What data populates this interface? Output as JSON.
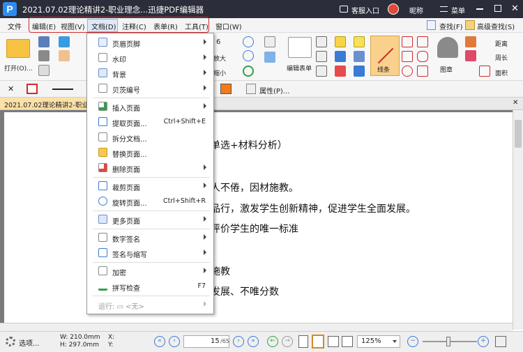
{
  "window": {
    "title": "2021.07.02理论精讲2-职业理念...迅捷PDF编辑器",
    "customer_service": "客服入口",
    "user_name": "昵称",
    "menu_label": "菜单"
  },
  "menubar": {
    "items": [
      "文件",
      "编辑(E)",
      "视图(V)",
      "文档(D)",
      "注释(C)",
      "表单(R)",
      "工具(T)",
      "窗口(W)"
    ],
    "find_label": "查找(F)",
    "advanced_find_label": "高级查找(S)"
  },
  "ribbon": {
    "open_label": "打开(O)...",
    "zoom_in_label": "放大",
    "zoom_out_label": "缩小",
    "edit_form_label": "编辑表单",
    "line_label": "线条",
    "stamp_label": "图章",
    "distance_label": "距离",
    "perimeter_label": "周长",
    "area_label": "面积",
    "partial_zoom": "6"
  },
  "formatbar": {
    "properties_label": "属性(P)..."
  },
  "tab": {
    "label": "2021.07.02理论精讲2-职业理"
  },
  "document": {
    "lines": [
      "单选+材料分析）",
      "人不倦，因材施教。",
      "品行，激发学生创新精神，促进学生全面发展。",
      "评价学生的唯一标准",
      "施教",
      "发展、不唯分数"
    ]
  },
  "dropdown": {
    "items": [
      {
        "label": "页眉页脚",
        "shortcut": "",
        "submenu": true,
        "icon": "header-footer-icon"
      },
      {
        "label": "水印",
        "shortcut": "",
        "submenu": true,
        "icon": "watermark-icon"
      },
      {
        "label": "背景",
        "shortcut": "",
        "submenu": true,
        "icon": "background-icon"
      },
      {
        "label": "贝茨编号",
        "shortcut": "",
        "submenu": true,
        "icon": "bates-number-icon"
      },
      {
        "label": "插入页面",
        "shortcut": "",
        "submenu": true,
        "icon": "insert-page-icon"
      },
      {
        "label": "提取页面...",
        "shortcut": "Ctrl+Shift+E",
        "submenu": false,
        "icon": "extract-page-icon"
      },
      {
        "label": "拆分文档...",
        "shortcut": "",
        "submenu": false,
        "icon": "split-document-icon"
      },
      {
        "label": "替换页面...",
        "shortcut": "",
        "submenu": false,
        "icon": "replace-page-icon"
      },
      {
        "label": "删除页面",
        "shortcut": "",
        "submenu": true,
        "icon": "delete-page-icon"
      },
      {
        "label": "裁剪页面",
        "shortcut": "",
        "submenu": true,
        "icon": "crop-page-icon"
      },
      {
        "label": "旋转页面...",
        "shortcut": "Ctrl+Shift+R",
        "submenu": false,
        "icon": "rotate-page-icon"
      },
      {
        "label": "更多页面",
        "shortcut": "",
        "submenu": true,
        "icon": "more-pages-icon"
      },
      {
        "label": "数字签名",
        "shortcut": "",
        "submenu": true,
        "icon": "digital-signature-icon"
      },
      {
        "label": "签名与缩写",
        "shortcut": "",
        "submenu": true,
        "icon": "sign-initial-icon"
      },
      {
        "label": "加密",
        "shortcut": "",
        "submenu": true,
        "icon": "encrypt-icon"
      },
      {
        "label": "拼写检查",
        "shortcut": "F7",
        "submenu": false,
        "icon": "spell-check-icon"
      },
      {
        "label": "运行: ▭ <无>",
        "shortcut": "",
        "submenu": true,
        "icon": ""
      }
    ]
  },
  "statusbar": {
    "options_label": "选项...",
    "width_label": "W: 210.0mm",
    "height_label": "H: 297.0mm",
    "x_label": "X:",
    "y_label": "Y:",
    "page_current": "15",
    "page_total": "/65",
    "zoom": "125%"
  },
  "colors": {
    "titlebar": "#2b2d3a",
    "accent_red": "#d42a2a",
    "accent_blue": "#3a7bd5"
  }
}
